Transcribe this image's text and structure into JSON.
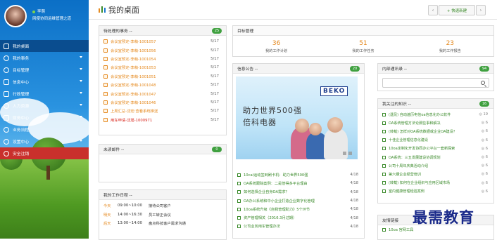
{
  "user": {
    "name": "李萌",
    "title": "网使协同运维管理之道"
  },
  "menu": [
    {
      "label": "我的桌面",
      "icon": "desktop-icon",
      "active": true,
      "caret": false
    },
    {
      "label": "我的事务",
      "icon": "clock-icon",
      "active": false,
      "caret": true
    },
    {
      "label": "目标管理",
      "icon": "target-icon",
      "active": false,
      "caret": true
    },
    {
      "label": "信息中心",
      "icon": "info-icon",
      "active": false,
      "caret": true
    },
    {
      "label": "行政管理",
      "icon": "briefcase-icon",
      "active": false,
      "caret": true
    },
    {
      "label": "人力资源",
      "icon": "users-icon",
      "active": false,
      "caret": true
    },
    {
      "label": "财务中心",
      "icon": "money-icon",
      "active": false,
      "caret": true
    },
    {
      "label": "业务流程",
      "icon": "flow-icon",
      "active": false,
      "caret": false
    },
    {
      "label": "设置中心",
      "icon": "gear-icon",
      "active": false,
      "caret": true
    },
    {
      "label": "安全注销",
      "icon": "power-icon",
      "active": false,
      "caret": false
    }
  ],
  "page": {
    "title": "我的桌面",
    "quick_label": "+ 快速新建"
  },
  "todo": {
    "title": "待处理的事务 --",
    "count": "25",
    "items": [
      {
        "t": "会议室预定-李萌-1001057",
        "d": "5/17",
        "red": false
      },
      {
        "t": "会议室预定-李萌-1001056",
        "d": "5/17",
        "red": false
      },
      {
        "t": "会议室预定-李萌-1001054",
        "d": "5/17",
        "red": false
      },
      {
        "t": "会议室预定-李萌-1001053",
        "d": "5/17",
        "red": false
      },
      {
        "t": "会议室预定-李萌-1001051",
        "d": "5/17",
        "red": false
      },
      {
        "t": "会议室预定-李萌-1001048",
        "d": "5/17",
        "red": false
      },
      {
        "t": "会议室预定-李萌-1001047",
        "d": "5/17",
        "red": false
      },
      {
        "t": "会议室预定-李萌-1001046",
        "d": "5/17",
        "red": false
      },
      {
        "t": "上周汇总-沈宏:查看系统推送",
        "d": "5/17",
        "red": false
      },
      {
        "t": "用车申请-沈旭-1000971",
        "d": "5/17",
        "red": true
      }
    ]
  },
  "mail": {
    "title": "未读邮件 --",
    "count": "0"
  },
  "schedule": {
    "title": "我的工作日程 --",
    "items": [
      {
        "day": "今天",
        "time": "09:00~10:00",
        "title": "接待公司客户"
      },
      {
        "day": "明天",
        "time": "14:00~16:30",
        "title": "员工转正会议"
      },
      {
        "day": "后天",
        "time": "13:00~14:00",
        "title": "盘点科技客户需求沟通"
      }
    ]
  },
  "goal": {
    "title": "目标管理",
    "cells": [
      {
        "num": "36",
        "label": "我的工作计划"
      },
      {
        "num": "51",
        "label": "我的工作任务"
      },
      {
        "num": "23",
        "label": "我的工作报告"
      }
    ]
  },
  "notice": {
    "title": "信息公告 --",
    "count": "20",
    "ad": {
      "brand": "BEKO",
      "line1": "助力世界500强",
      "line2": "倍科电器"
    },
    "items": [
      {
        "t": "10cai运动签到刷卡机：助力世界500强",
        "d": "4/18"
      },
      {
        "t": "OA系统跟踪案例：二是倍得多平台理由",
        "d": "4/18"
      },
      {
        "t": "如何选择企业自身OA需求？",
        "d": "4/18"
      },
      {
        "t": "OA办公系统和中小企业打造企业数字化管理",
        "d": "4/18"
      },
      {
        "t": "10oa系统升级《自我管理助力》5个环节",
        "d": "4/18"
      },
      {
        "t": "资产管理相关（2016.3月过期）",
        "d": "4/18"
      },
      {
        "t": "公司业务用车管理办法",
        "d": "4/18"
      }
    ]
  },
  "inner": {
    "title": "内部通讯录 --",
    "count": "94",
    "search_placeholder": ""
  },
  "knowledge": {
    "title": "我关注的知识 --",
    "count": "16",
    "items": [
      {
        "t": "(遇见) 自动遍历电信oa信息化办公软件",
        "c": "19"
      },
      {
        "t": "OA系统管理方法论那些事和解决",
        "c": "6"
      },
      {
        "t": "(转载) 怎样对OA系统数据或企业OA建设？",
        "c": "6"
      },
      {
        "t": "十佳企业管理信息化建设",
        "c": "6"
      },
      {
        "t": "10oa定制化开发协同办公平台一套新探索",
        "c": "6"
      },
      {
        "t": "OA系统：三五发展建设协调规划",
        "c": "6"
      },
      {
        "t": "公司十周年庆典活动介绍",
        "c": "6"
      },
      {
        "t": "第六期企业经营培训",
        "c": "6"
      },
      {
        "t": "(转载) 如何在企业组织与应用区域市场",
        "c": "6"
      },
      {
        "t": "室内健康管理经验案例",
        "c": "6"
      }
    ]
  },
  "links": {
    "title": "友情链接",
    "items": [
      {
        "t": "10oa 官网工具"
      }
    ]
  },
  "watermark": "最需教育"
}
